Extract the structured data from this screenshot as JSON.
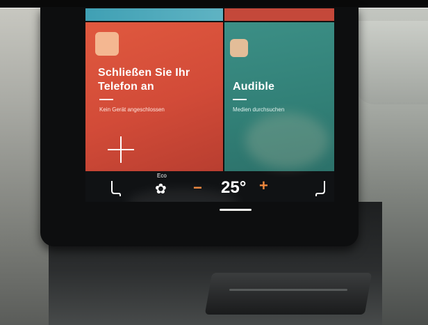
{
  "screen": {
    "phone_tile": {
      "title_line1": "Schließen Sie Ihr",
      "title_line2": "Telefon an",
      "subtitle": "Kein Gerät angeschlossen",
      "icon": "phone-app-icon",
      "add_icon": "plus-icon"
    },
    "audio_tile": {
      "title": "Audible",
      "subtitle": "Medien durchsuchen",
      "icon": "audible-app-icon"
    },
    "climate": {
      "eco_label": "Eco",
      "fan_icon": "fan-icon",
      "decrease_label": "−",
      "temperature": "25°",
      "increase_label": "+",
      "left_seat_icon": "seat-heater-left-icon",
      "right_seat_icon": "seat-heater-right-icon"
    }
  },
  "colors": {
    "phone_tile": "#d24b38",
    "audio_tile": "#317f76",
    "accent_orange": "#f0883d"
  }
}
